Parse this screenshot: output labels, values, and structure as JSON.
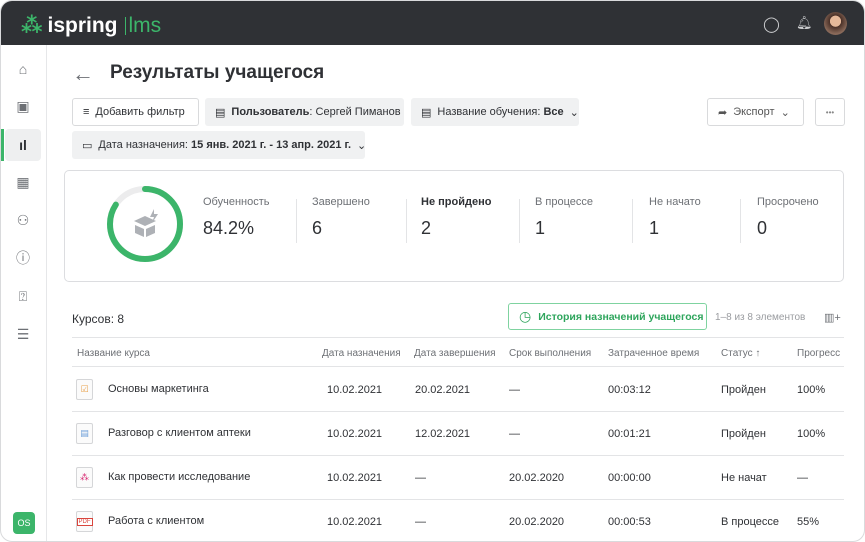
{
  "header": {
    "logo": "ispring",
    "logo_suffix": "lms"
  },
  "sidebar": {
    "user_initials": "OS"
  },
  "page": {
    "title": "Результаты учащегося"
  },
  "filters": {
    "add_filter": "Добавить фильтр",
    "user_label": "Пользователь",
    "user_value": ": Сергей Пиманов",
    "training_label": "Название обучения: ",
    "training_value": "Все",
    "date_label": "Дата назначения: ",
    "date_value": "15 янв. 2021 г. - 13 апр. 2021 г.",
    "export": "Экспорт",
    "more": "•••"
  },
  "stats": {
    "proficiency_percent": 84.2,
    "items": [
      {
        "label": "Обученность",
        "value": "84.2%"
      },
      {
        "label": "Завершено",
        "value": "6"
      },
      {
        "label": "Не пройдено",
        "value": "2"
      },
      {
        "label": "В процессе",
        "value": "1"
      },
      {
        "label": "Не начато",
        "value": "1"
      },
      {
        "label": "Просрочено",
        "value": "0"
      }
    ]
  },
  "table": {
    "count": "Курсов: 8",
    "history_button": "История назначений учащегося",
    "pager": "1–8 из 8 элементов",
    "columns_button": "+",
    "headers": [
      "Название курса",
      "Дата назначения",
      "Дата завершения",
      "Срок выполнения",
      "Затраченное время",
      "Статус ↑",
      "Прогресс"
    ],
    "rows": [
      {
        "icon": "quiz",
        "name": "Основы маркетинга",
        "assigned": "10.02.2021",
        "completed": "20.02.2021",
        "due": "—",
        "time": "00:03:12",
        "status": "Пройден",
        "progress": "100%"
      },
      {
        "icon": "dialog",
        "name": "Разговор с клиентом аптеки",
        "assigned": "10.02.2021",
        "completed": "12.02.2021",
        "due": "—",
        "time": "00:01:21",
        "status": "Пройден",
        "progress": "100%"
      },
      {
        "icon": "ispring",
        "name": "Как провести исследование",
        "assigned": "10.02.2021",
        "completed": "—",
        "due": "20.02.2020",
        "time": "00:00:00",
        "status": "Не начат",
        "progress": "—"
      },
      {
        "icon": "pdf",
        "name": "Работа с клиентом",
        "assigned": "10.02.2021",
        "completed": "—",
        "due": "20.02.2020",
        "time": "00:00:53",
        "status": "В процессе",
        "progress": "55%"
      }
    ]
  },
  "icon_labels": {
    "pdf": "PDF"
  },
  "colors": {
    "accent": "#3cb56a",
    "topbar": "#2f3135"
  }
}
